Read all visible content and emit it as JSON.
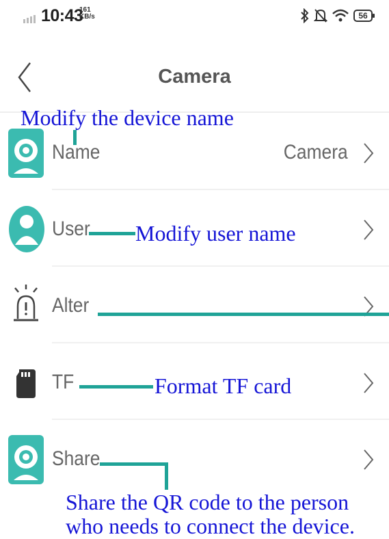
{
  "status_bar": {
    "time": "10:43",
    "net_speed_value": "161",
    "net_speed_unit": "KB/s",
    "battery": "56",
    "icons": [
      "signal-icon",
      "bluetooth-icon",
      "mute-icon",
      "wifi-icon",
      "battery-icon"
    ]
  },
  "header": {
    "title": "Camera",
    "back_icon": "back-arrow-icon"
  },
  "rows": [
    {
      "label": "Name",
      "value": "Camera",
      "icon": "camera-icon"
    },
    {
      "label": "User",
      "value": "",
      "icon": "user-icon"
    },
    {
      "label": "Alter",
      "value": "",
      "icon": "alarm-icon"
    },
    {
      "label": "TF",
      "value": "",
      "icon": "sd-card-icon"
    },
    {
      "label": "Share",
      "value": "",
      "icon": "camera-icon"
    }
  ],
  "annotations": {
    "name": "Modify the device name",
    "user": "Modify user name",
    "tf": "Format TF card",
    "share_line1": "Share the QR code to the person",
    "share_line2": "who needs to connect the device."
  },
  "colors": {
    "accent_teal": "#1fa397",
    "annotation_blue": "#1515d6",
    "icon_teal": "#3bbbb0"
  }
}
